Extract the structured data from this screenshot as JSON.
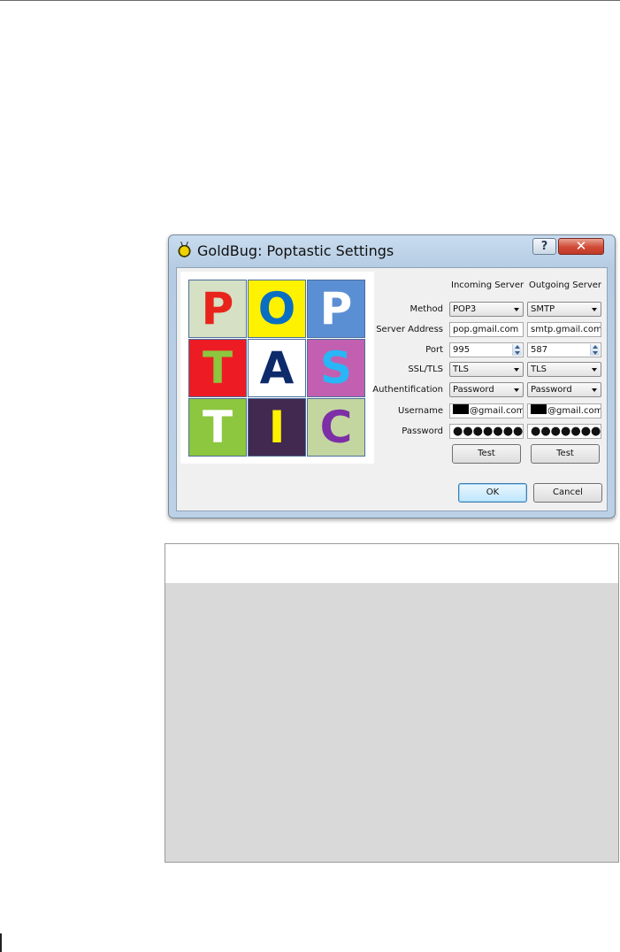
{
  "window": {
    "title": "GoldBug: Poptastic Settings",
    "help_label": "?",
    "close_label": "✕"
  },
  "logo": {
    "tiles": [
      {
        "letter": "P",
        "bg": "#d5e0c4",
        "fg": "#e8231b"
      },
      {
        "letter": "O",
        "bg": "#fff200",
        "fg": "#0a6fc2"
      },
      {
        "letter": "P",
        "bg": "#5b8fd4",
        "fg": "#ffffff"
      },
      {
        "letter": "T",
        "bg": "#ed1c24",
        "fg": "#8dc63f"
      },
      {
        "letter": "A",
        "bg": "#ffffff",
        "fg": "#0d2a6b"
      },
      {
        "letter": "S",
        "bg": "#c25fb0",
        "fg": "#29b6f6"
      },
      {
        "letter": "T",
        "bg": "#8dc63f",
        "fg": "#ffffff"
      },
      {
        "letter": "I",
        "bg": "#42294f",
        "fg": "#fff200"
      },
      {
        "letter": "C",
        "bg": "#c3d6a0",
        "fg": "#7d2fa6"
      }
    ]
  },
  "form": {
    "incoming_header": "Incoming Server",
    "outgoing_header": "Outgoing Server",
    "labels": {
      "method": "Method",
      "server_address": "Server Address",
      "port": "Port",
      "ssl_tls": "SSL/TLS",
      "authentification": "Authentification",
      "username": "Username",
      "password": "Password"
    },
    "incoming": {
      "method": "POP3",
      "server_address": "pop.gmail.com",
      "port": "995",
      "ssl_tls": "TLS",
      "authentification": "Password",
      "username_suffix": "@gmail.com",
      "password_mask": "●●●●●●●●●"
    },
    "outgoing": {
      "method": "SMTP",
      "server_address": "smtp.gmail.com",
      "port": "587",
      "ssl_tls": "TLS",
      "authentification": "Password",
      "username_suffix": "@gmail.com",
      "password_mask": "●●●●●●●●●"
    },
    "test_label": "Test"
  },
  "buttons": {
    "ok": "OK",
    "cancel": "Cancel"
  }
}
